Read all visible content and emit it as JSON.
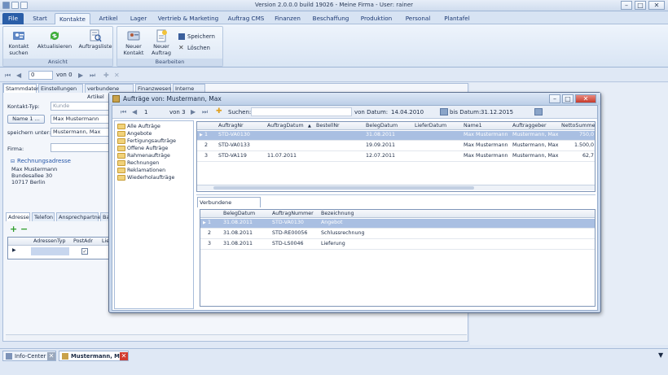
{
  "window": {
    "title": "Version 2.0.0.0  build 19026 - Meine Firma - User: rainer"
  },
  "menu": {
    "file": "File",
    "tabs": [
      "Start",
      "Kontakte",
      "Artikel",
      "Lager",
      "Vertrieb & Marketing",
      "Auftrag CMS",
      "Finanzen",
      "Beschaffung",
      "Produktion",
      "Personal",
      "Plantafel"
    ],
    "active": "Kontakte"
  },
  "ribbon": {
    "group_ansicht": "Ansicht",
    "group_bearbeiten": "Bearbeiten",
    "kontakt_suchen_1": "Kontakt",
    "kontakt_suchen_2": "suchen",
    "aktualisieren": "Aktualisieren",
    "auftragsliste": "Auftragsliste",
    "neuer_kontakt_1": "Neuer",
    "neuer_kontakt_2": "Kontakt",
    "neuer_auftrag_1": "Neuer",
    "neuer_auftrag_2": "Auftrag",
    "speichern": "Speichern",
    "loeschen": "Löschen"
  },
  "navbar": {
    "page": "0",
    "von": "von 0"
  },
  "contact": {
    "tabs": [
      "Stammdaten",
      "Einstellungen",
      "verbundene Artikel",
      "Finanzwesen",
      "Interne Infos"
    ],
    "kontakt_typ_label": "Kontakt-Typ:",
    "kontakt_typ_value": "Kunde",
    "name_button": "Name 1 ...",
    "name_value": "Max Mustermann",
    "speichern_unter_label": "speichern unter:",
    "speichern_unter_value": "Mustermann, Max",
    "firma_label": "Firma:",
    "rechnungsadresse_label": "Rechnungsadresse",
    "address_lines": [
      "Max Mustermann",
      "Bundesallee 30",
      "10717 Berlin"
    ],
    "address_tabs": [
      "Adresse",
      "Telefon",
      "Ansprechpartner",
      "Ban"
    ],
    "addr_grid_headers": [
      "AdressenTyp",
      "PostAdr",
      "Lief"
    ]
  },
  "dialog": {
    "title": "Aufträge von: Mustermann, Max",
    "nav_page": "1",
    "nav_von": "von 3",
    "suchen_label": "Suchen:",
    "von_datum_label": "von Datum:",
    "von_datum_value": "14.04.2010",
    "bis_datum_label": "bis Datum:",
    "bis_datum_value": "31.12.2015",
    "tree": [
      "Alle Aufträge",
      "Angebote",
      "Fertigungsaufträge",
      "Offene Aufträge",
      "Rahmenaufträge",
      "Rechnungen",
      "Reklamationen",
      "Wiederholaufträge"
    ],
    "orders_headers": [
      "AuftragNr",
      "AuftragDatum",
      "BestellNr",
      "BelegDatum",
      "LieferDatum",
      "Name1",
      "Auftraggeber",
      "NettoSumme"
    ],
    "orders": [
      {
        "idx": "1",
        "nr": "STD-VA0130",
        "adatum": "",
        "bestell": "",
        "beleg": "31.08.2011",
        "liefer": "",
        "name1": "Max Mustermann",
        "auftraggeber": "Mustermann, Max",
        "netto": "750,0"
      },
      {
        "idx": "2",
        "nr": "STD-VA0133",
        "adatum": "",
        "bestell": "",
        "beleg": "19.09.2011",
        "liefer": "",
        "name1": "Max Mustermann",
        "auftraggeber": "Mustermann, Max",
        "netto": "1.500,0"
      },
      {
        "idx": "3",
        "nr": "STD-VA119",
        "adatum": "11.07.2011",
        "bestell": "",
        "beleg": "12.07.2011",
        "liefer": "",
        "name1": "Max Mustermann",
        "auftraggeber": "Mustermann, Max",
        "netto": "62,7"
      }
    ],
    "docs_tab": "Verbundene Dokumente",
    "docs_headers": [
      "BelegDatum",
      "AuftragNummer",
      "Bezeichnung"
    ],
    "docs": [
      {
        "idx": "1",
        "datum": "31.08.2011",
        "nummer": "STD-VA0130",
        "bez": "Angebot"
      },
      {
        "idx": "2",
        "datum": "31.08.2011",
        "nummer": "STD-RE00056",
        "bez": "Schlussrechnung"
      },
      {
        "idx": "3",
        "datum": "31.08.2011",
        "nummer": "STD-LS0046",
        "bez": "Lieferung"
      }
    ]
  },
  "bottom_tabs": [
    "Info-Center",
    "Mustermann, Max"
  ],
  "colors": {
    "accent": "#2a5ea8",
    "selection": "#a9bfe2",
    "close_red": "#d23b2f"
  }
}
